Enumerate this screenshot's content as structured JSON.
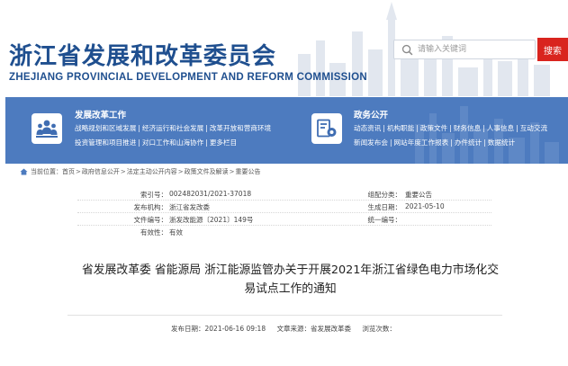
{
  "header": {
    "title": "浙江省发展和改革委员会",
    "subtitle": "ZHEJIANG PROVINCIAL DEVELOPMENT AND REFORM COMMISSION",
    "search_placeholder": "请输入关键词",
    "search_button": "搜索"
  },
  "nav": {
    "left": {
      "title": "发展改革工作",
      "row1": [
        "战略规划和区域发展",
        "经济运行和社会发展",
        "改革开放和营商环境"
      ],
      "row2": [
        "投资管理和项目推进",
        "对口工作和山海协作",
        "更多栏目"
      ]
    },
    "right": {
      "title": "政务公开",
      "row1": [
        "动态资讯",
        "机构职能",
        "政策文件",
        "财务信息",
        "人事信息",
        "互动交流"
      ],
      "row2": [
        "新闻发布会",
        "网站年度工作报表",
        "办件统计",
        "数据统计"
      ]
    }
  },
  "breadcrumb": {
    "items": [
      "当前位置：",
      "首页",
      "政府信息公开",
      "法定主动公开内容",
      "政策文件及解读",
      "重要公告"
    ]
  },
  "meta": {
    "index_label": "索引号：",
    "index_value": "002482031/2021-37018",
    "org_label": "发布机构：",
    "org_value": "浙江省发改委",
    "docno_label": "文件编号：",
    "docno_value": "浙发改能源〔2021〕149号",
    "valid_label": "有效性：",
    "valid_value": "有效",
    "cat_label": "组配分类：",
    "cat_value": "重要公告",
    "date_label": "生成日期：",
    "date_value": "2021-05-10",
    "uni_label": "统一编号：",
    "uni_value": ""
  },
  "article": {
    "title_line1": "省发展改革委 省能源局 浙江能源监管办关于开展2021年浙江省绿色电力市场化交",
    "title_line2": "易试点工作的通知",
    "publish_label": "发布日期：",
    "publish_value": "2021-06-16 09:18",
    "source_label": "文章来源：",
    "source_value": "省发展改革委",
    "views_label": "浏览次数：",
    "views_value": ""
  },
  "colors": {
    "brand_blue": "#1f4f8f",
    "nav_blue": "#4d7bbf",
    "search_red": "#d9241e"
  }
}
